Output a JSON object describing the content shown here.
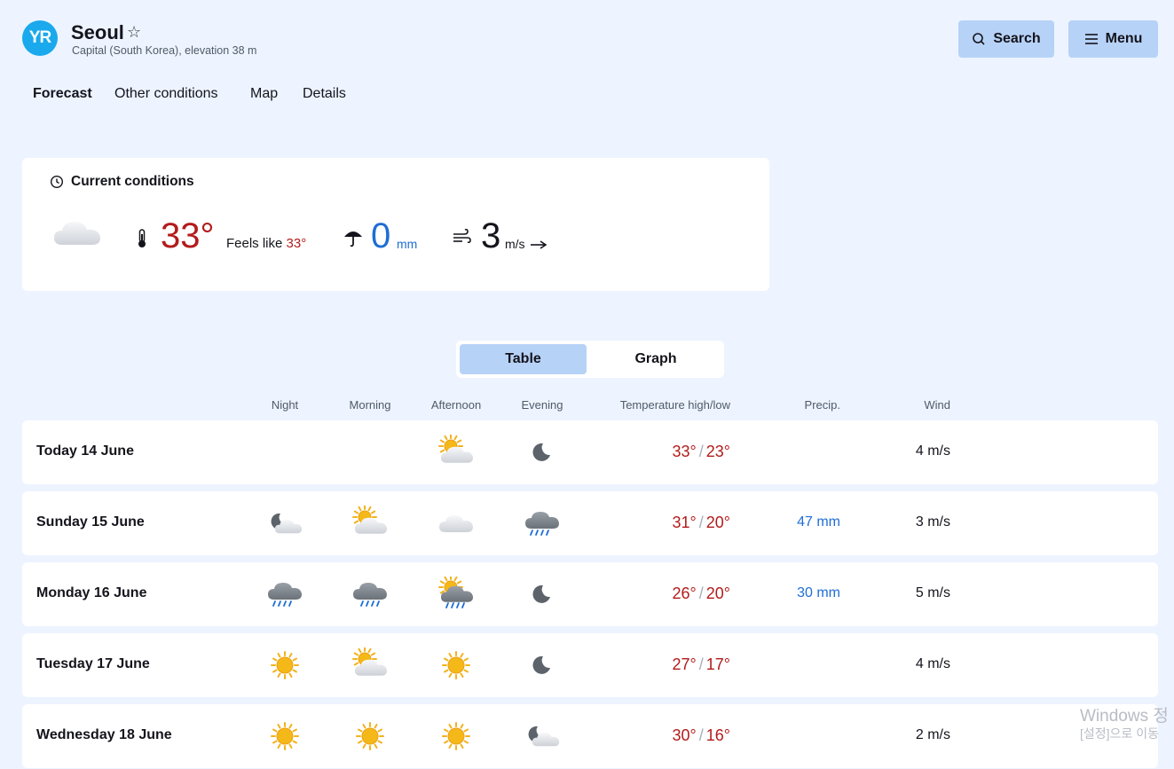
{
  "header": {
    "logo_text": "YR",
    "city": "Seoul",
    "subtitle": "Capital (South Korea), elevation 38 m",
    "search_label": "Search",
    "menu_label": "Menu"
  },
  "nav": {
    "forecast": "Forecast",
    "other": "Other conditions",
    "map": "Map",
    "details": "Details"
  },
  "current": {
    "title": "Current conditions",
    "icon": "cloudy-icon",
    "temperature": "33°",
    "feels_like_label": "Feels like",
    "feels_like_value": "33°",
    "precip_value": "0",
    "precip_unit": "mm",
    "wind_value": "3",
    "wind_unit": "m/s"
  },
  "view_toggle": {
    "table": "Table",
    "graph": "Graph",
    "selected": "Table"
  },
  "columns": {
    "night": "Night",
    "morning": "Morning",
    "afternoon": "Afternoon",
    "evening": "Evening",
    "temp": "Temperature high/low",
    "precip": "Precip.",
    "wind": "Wind"
  },
  "days": [
    {
      "label": "Today 14 June",
      "night": "",
      "morning": "",
      "afternoon": "partly-cloudy-day",
      "evening": "clear-night",
      "high": "33°",
      "low": "23°",
      "precip": "",
      "wind": "4 m/s"
    },
    {
      "label": "Sunday 15 June",
      "night": "partly-cloudy-night",
      "morning": "partly-cloudy-day",
      "afternoon": "cloudy",
      "evening": "rain",
      "high": "31°",
      "low": "20°",
      "precip": "47 mm",
      "wind": "3 m/s"
    },
    {
      "label": "Monday 16 June",
      "night": "rain",
      "morning": "light-rain",
      "afternoon": "rain-showers-day",
      "evening": "clear-night",
      "high": "26°",
      "low": "20°",
      "precip": "30 mm",
      "wind": "5 m/s"
    },
    {
      "label": "Tuesday 17 June",
      "night": "sun",
      "morning": "partly-cloudy-day",
      "afternoon": "sun",
      "evening": "clear-night",
      "high": "27°",
      "low": "17°",
      "precip": "",
      "wind": "4 m/s"
    },
    {
      "label": "Wednesday 18 June",
      "night": "sun",
      "morning": "sun",
      "afternoon": "sun",
      "evening": "partly-cloudy-night",
      "high": "30°",
      "low": "16°",
      "precip": "",
      "wind": "2 m/s"
    }
  ],
  "watermark": {
    "line1": "Windows 정",
    "line2": "[설정]으로 이동"
  },
  "colors": {
    "background": "#edf4ff",
    "accent": "#b7d2f7",
    "temperature": "#b31b1b",
    "precip": "#1f6ed4",
    "logo": "#1aa9ec"
  }
}
